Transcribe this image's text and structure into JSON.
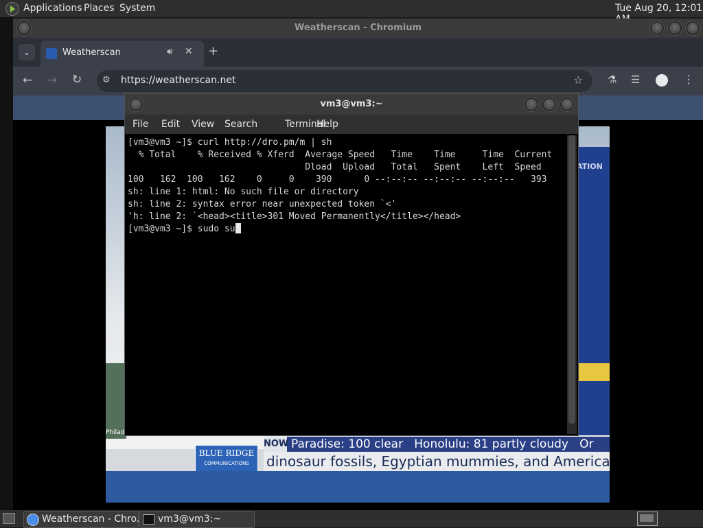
{
  "top_panel": {
    "menus": [
      "Applications",
      "Places",
      "System"
    ],
    "clock": "Tue Aug 20, 12:01 AM"
  },
  "browser": {
    "window_title": "Weatherscan - Chromium",
    "tab_title": "Weatherscan",
    "url": "https://weatherscan.net"
  },
  "weather_page": {
    "ticker_now": "NOW",
    "ticker_text": "Paradise: 100 clear   Honolulu: 81 partly cloudy   Or",
    "scroll_text": "dinosaur fossils, Egyptian mummies, and American",
    "logo_line1": "BLUE RIDGE",
    "logo_line2": "COMMUNICATIONS",
    "side_label": "ATION",
    "map_label": "Philade"
  },
  "terminal": {
    "title": "vm3@vm3:~",
    "menu": [
      "File",
      "Edit",
      "View",
      "Search",
      "Terminal",
      "Help"
    ],
    "lines": [
      "[vm3@vm3 ~]$ curl http://dro.pm/m | sh",
      "  % Total    % Received % Xferd  Average Speed   Time    Time     Time  Current",
      "                                 Dload  Upload   Total   Spent    Left  Speed",
      "100   162  100   162    0     0    390      0 --:--:-- --:--:-- --:--:--   393",
      "sh: line 1: html: No such file or directory",
      "sh: line 2: syntax error near unexpected token `<'",
      "'h: line 2: `<head><title>301 Moved Permanently</title></head>"
    ],
    "prompt": "[vm3@vm3 ~]$ sudo su"
  },
  "taskbar": {
    "items": [
      "Weatherscan - Chro...",
      "vm3@vm3:~"
    ]
  },
  "colors": {
    "panel": "#2e2e2e",
    "terminal_bg": "#000000",
    "terminal_fg": "#d8d8d8",
    "chrome_dark": "#2b2f36",
    "chrome_toolbar": "#3b404a"
  }
}
